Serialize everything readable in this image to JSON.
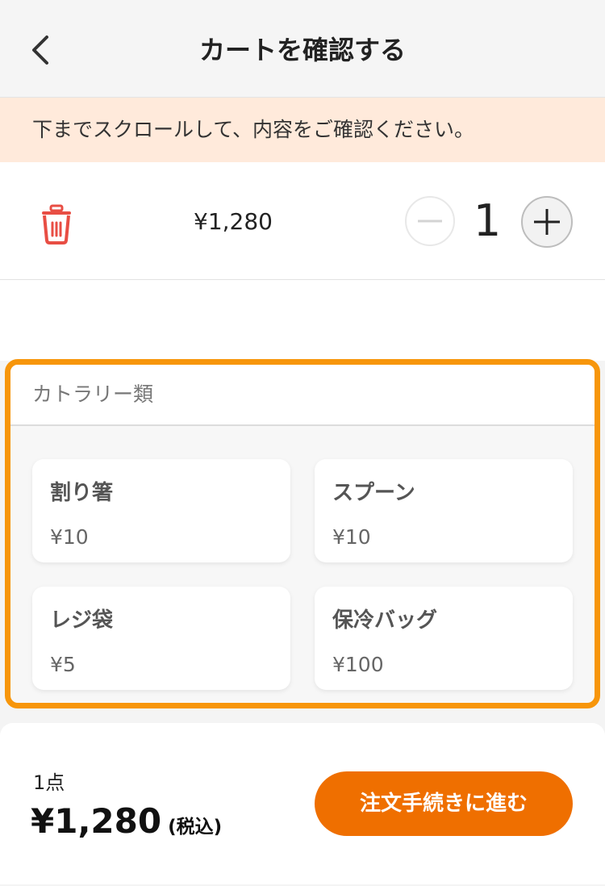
{
  "header": {
    "title": "カートを確認する"
  },
  "notice": "下までスクロールして、内容をご確認ください。",
  "cart_item": {
    "price": "¥1,280",
    "quantity": "1"
  },
  "cutlery": {
    "title": "カトラリー類",
    "items": [
      {
        "name": "割り箸",
        "price": "¥10"
      },
      {
        "name": "スプーン",
        "price": "¥10"
      },
      {
        "name": "レジ袋",
        "price": "¥5"
      },
      {
        "name": "保冷バッグ",
        "price": "¥100"
      }
    ]
  },
  "footer": {
    "count": "1点",
    "total": "¥1,280",
    "tax_note": "(税込)",
    "checkout_label": "注文手続きに進む"
  },
  "colors": {
    "accent": "#ef6f00",
    "highlight_border": "#f7960b",
    "notice_bg": "#ffeadb",
    "trash": "#e84e44"
  }
}
